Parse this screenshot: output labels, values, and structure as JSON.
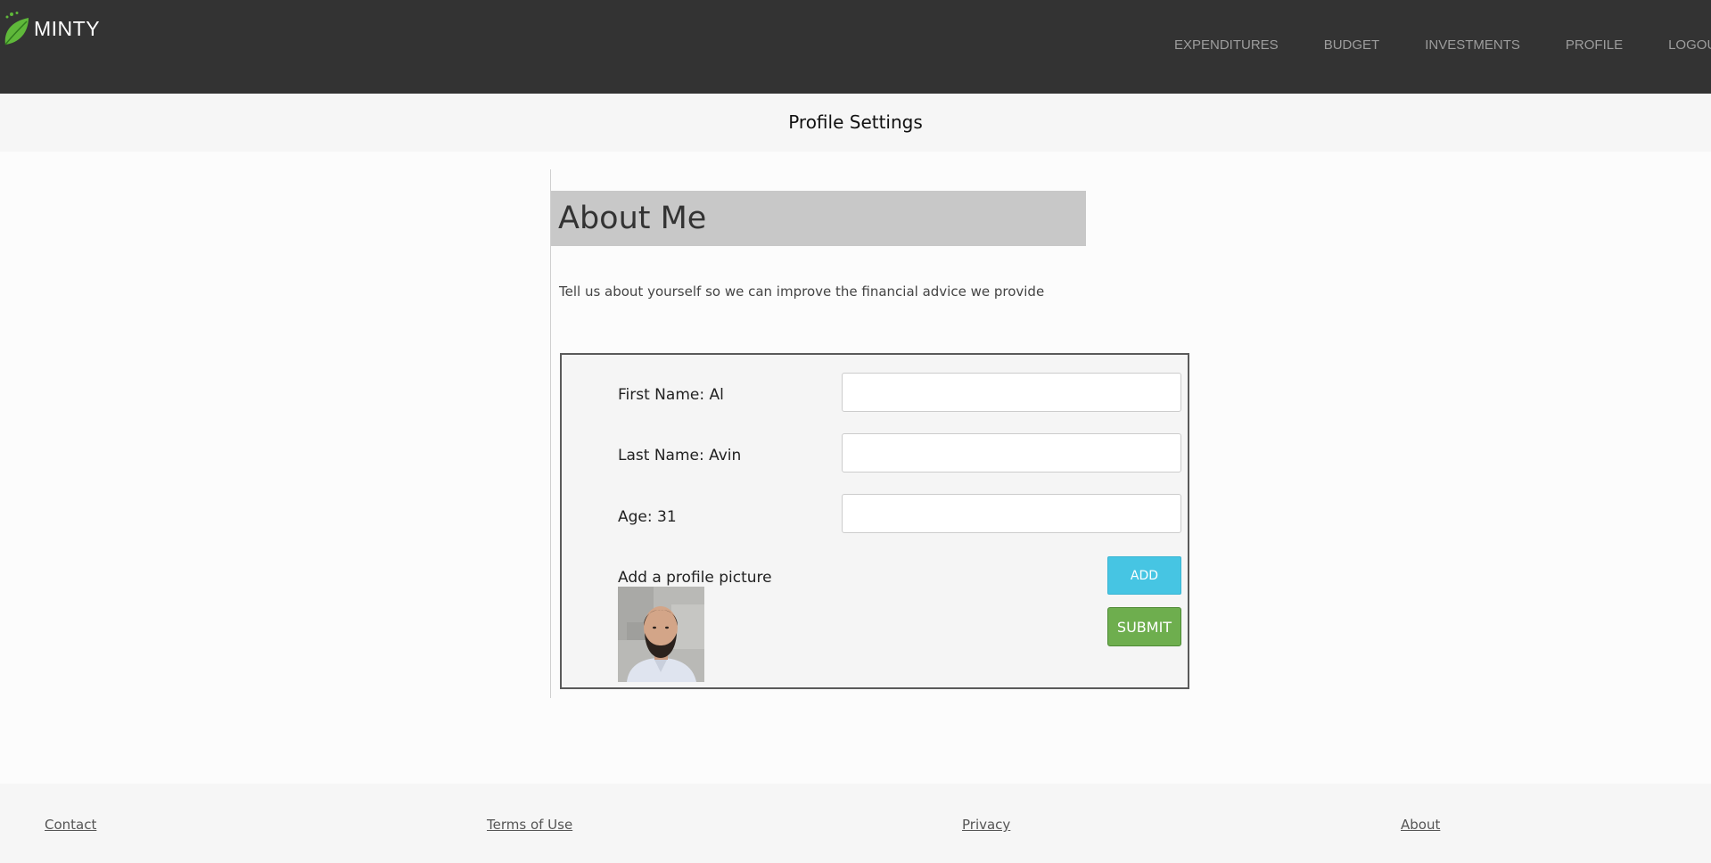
{
  "navbar": {
    "brand": "MINTY",
    "items": [
      {
        "label": "EXPENDITURES"
      },
      {
        "label": "BUDGET"
      },
      {
        "label": "INVESTMENTS"
      },
      {
        "label": "PROFILE"
      },
      {
        "label": "LOGOUT"
      }
    ]
  },
  "page": {
    "title": "Profile Settings"
  },
  "about": {
    "heading": "About Me",
    "intro": "Tell us about yourself so we can improve the financial advice we provide"
  },
  "form": {
    "first_name_label": "First Name: Al",
    "last_name_label": "Last Name: Avin",
    "age_label": "Age: 31",
    "first_name_value": "",
    "last_name_value": "",
    "age_value": "",
    "picture_label": "Add a profile picture",
    "add_label": "ADD",
    "submit_label": "SUBMIT"
  },
  "footer": {
    "contact": "Contact",
    "terms": "Terms of Use",
    "privacy": "Privacy",
    "about": "About"
  },
  "colors": {
    "navbar_bg": "#333333",
    "nav_text": "#9d9d9d",
    "logo_leaf": "#5fb83a",
    "add_button": "#46c5e3",
    "submit_button": "#6eae4e"
  },
  "icons": {
    "logo": "leaf-icon",
    "profile_picture": "profile-photo"
  }
}
